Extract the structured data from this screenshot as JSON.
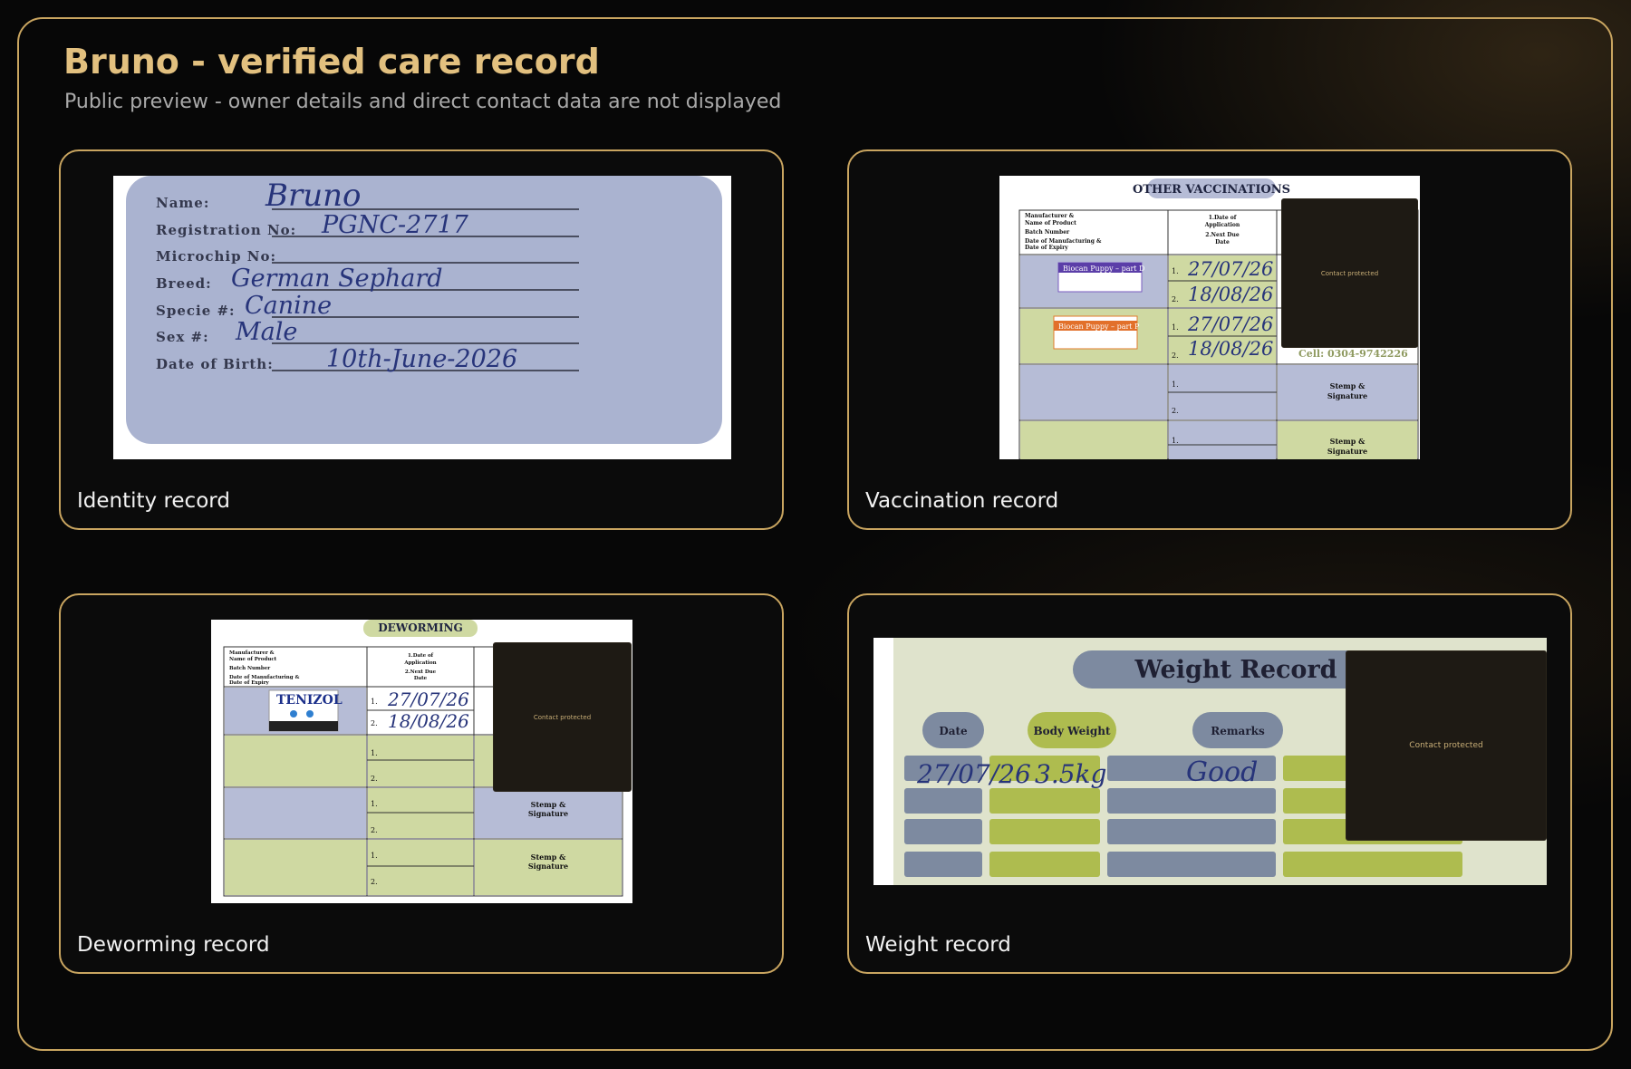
{
  "header": {
    "title": "Bruno - verified care record",
    "subtitle": "Public preview - owner details and direct contact data are not displayed"
  },
  "mask_text": "Contact protected",
  "identity": {
    "label": "Identity record",
    "fields": [
      {
        "key": "Name:",
        "value": "Bruno"
      },
      {
        "key": "Registration No:",
        "value": "PGNC-2717"
      },
      {
        "key": "Microchip No:",
        "value": ""
      },
      {
        "key": "Breed:",
        "value": "German Sephard"
      },
      {
        "key": "Specie #:",
        "value": "Canine"
      },
      {
        "key": "Sex #:",
        "value": "Male"
      },
      {
        "key": "Date of Birth:",
        "value": "10th-June-2026"
      }
    ]
  },
  "vaccination": {
    "label": "Vaccination record",
    "heading": "OTHER VACCINATIONS",
    "col1": [
      "Manufacturer &",
      "Name of Product",
      "Batch Number",
      "Date of Manufacturing &",
      "Date of Expiry"
    ],
    "col2": [
      "1.Date of",
      "Application",
      "2.Next Due",
      "Date"
    ],
    "sticker1": "Biocan Puppy – part D",
    "sticker2": "Biocan Puppy – part P",
    "dates": [
      "27/07/26",
      "18/08/26",
      "27/07/26",
      "18/08/26"
    ],
    "num1": "1.",
    "num2": "2.",
    "cell": "Cell: 0304-9742226",
    "stamp": [
      "Stemp &",
      "Signature"
    ]
  },
  "deworming": {
    "label": "Deworming record",
    "heading": "DEWORMING",
    "col1": [
      "Manufacturer &",
      "Name of Product",
      "Batch Number",
      "Date of Manufacturing &",
      "Date of Expiry"
    ],
    "col2": [
      "1.Date of",
      "Application",
      "2.Next Due",
      "Date"
    ],
    "product": "TENIZOL",
    "dates": [
      "27/07/26",
      "18/08/26"
    ],
    "num1": "1.",
    "num2": "2.",
    "stamp": [
      "Stemp &",
      "Signature"
    ]
  },
  "weight": {
    "label": "Weight record",
    "heading": "Weight Record",
    "columns": [
      "Date",
      "Body Weight",
      "Remarks"
    ],
    "entry": {
      "date": "27/07/26",
      "weight": "3.5kg",
      "remark": "Good"
    }
  }
}
